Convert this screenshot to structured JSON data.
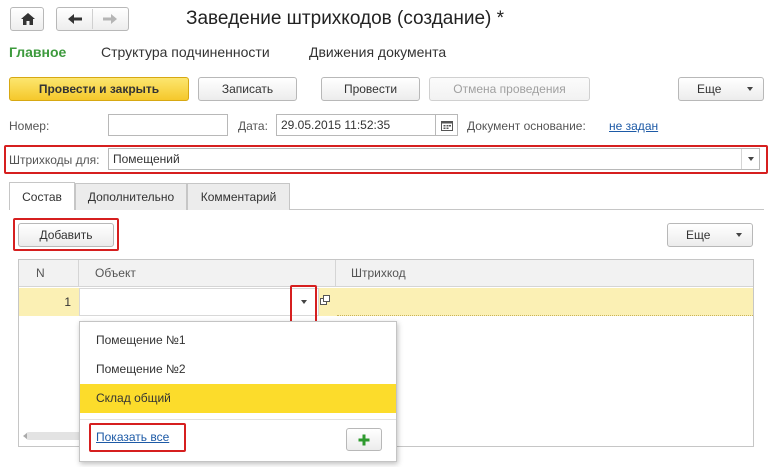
{
  "window": {
    "title": "Заведение штрихкодов (создание) *",
    "star": "☆"
  },
  "nav": {
    "home_icon": "home-icon",
    "back_icon": "arrow-left-icon",
    "forward_icon": "arrow-right-icon"
  },
  "section_tabs": [
    {
      "label": "Главное",
      "active": true
    },
    {
      "label": "Структура подчиненности",
      "active": false
    },
    {
      "label": "Движения документа",
      "active": false
    }
  ],
  "toolbar": {
    "post_close": "Провести и закрыть",
    "save": "Записать",
    "post": "Провести",
    "cancel_post": "Отмена проведения",
    "more": "Еще"
  },
  "form": {
    "number_label": "Номер:",
    "number_value": "",
    "date_label": "Дата:",
    "date_value": "29.05.2015 11:52:35",
    "basis_label": "Документ основание:",
    "basis_value": "не задан",
    "barcodes_for_label": "Штрихкоды для:",
    "barcodes_for_value": "Помещений"
  },
  "tabs": [
    {
      "label": "Состав",
      "active": true
    },
    {
      "label": "Дополнительно",
      "active": false
    },
    {
      "label": "Комментарий",
      "active": false
    }
  ],
  "table_toolbar": {
    "add": "Добавить",
    "more": "Еще"
  },
  "table": {
    "columns": [
      "N",
      "Объект",
      "Штрихкод"
    ],
    "rows": [
      {
        "n": "1",
        "object": "",
        "barcode": ""
      }
    ]
  },
  "dropdown": {
    "items": [
      "Помещение №1",
      "Помещение №2",
      "Склад общий"
    ],
    "selected_index": 2,
    "show_all": "Показать все",
    "add_icon": "plus-icon"
  },
  "colors": {
    "accent_green": "#3d9a3d",
    "primary_yellow": "#f5c82b",
    "selection_yellow": "#fcdc2b",
    "row_yellow": "#fbf0b4",
    "link_blue": "#1d5aa6",
    "highlight_red": "#d61f1f"
  }
}
